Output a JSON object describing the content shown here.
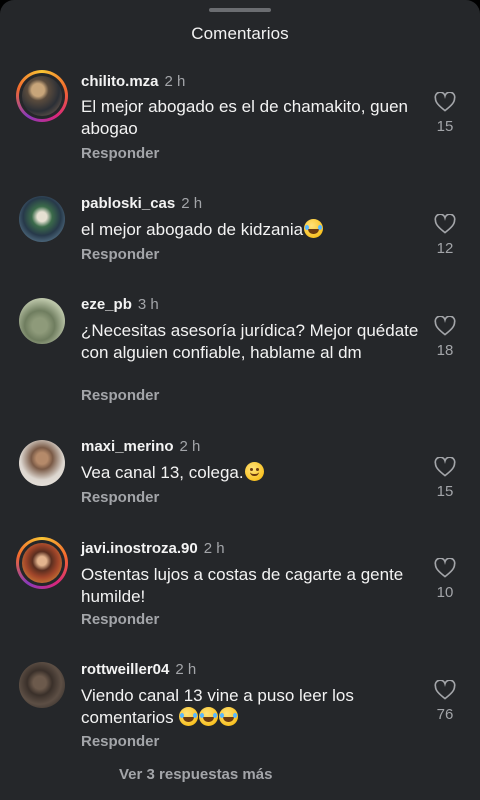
{
  "header": {
    "title": "Comentarios"
  },
  "comments": [
    {
      "username": "chilito.mza",
      "time": "2 h",
      "text": "El mejor abogado es el de chamakito, guen abogao",
      "emojis": [],
      "reply_label": "Responder",
      "likes": "15",
      "avatar_ring": true
    },
    {
      "username": "pabloski_cas",
      "time": "2 h",
      "text": "el mejor abogado de kidzania",
      "emojis": [
        "face-with-tears-of-joy"
      ],
      "reply_label": "Responder",
      "likes": "12",
      "avatar_ring": false
    },
    {
      "username": "eze_pb",
      "time": "3 h",
      "text": "¿Necesitas asesoría jurídica? Mejor quédate con alguien confiable, hablame al dm",
      "emojis": [],
      "reply_label": "Responder",
      "likes": "18",
      "avatar_ring": false
    },
    {
      "username": "maxi_merino",
      "time": "2 h",
      "text": "Vea canal 13, colega.",
      "emojis": [
        "slightly-smiling-face"
      ],
      "reply_label": "Responder",
      "likes": "15",
      "avatar_ring": false
    },
    {
      "username": "javi.inostroza.90",
      "time": "2 h",
      "text": "Ostentas lujos a costas de cagarte a gente humilde!",
      "emojis": [],
      "reply_label": "Responder",
      "likes": "10",
      "avatar_ring": true
    },
    {
      "username": "rottweiller04",
      "time": "2 h",
      "text_line1": "Viendo canal 13 vine a puso leer los",
      "text_line2": "comentarios",
      "emojis": [
        "face-with-tears-of-joy",
        "face-with-tears-of-joy",
        "face-with-tears-of-joy"
      ],
      "reply_label": "Responder",
      "likes": "76",
      "avatar_ring": false
    }
  ],
  "footer": {
    "view_more_label": "Ver 3 respuestas más"
  },
  "icons": {
    "like": "heart-outline-icon"
  },
  "colors": {
    "background": "#25272a",
    "text_primary": "#f3f3f3",
    "text_secondary": "#a3a5a9"
  }
}
